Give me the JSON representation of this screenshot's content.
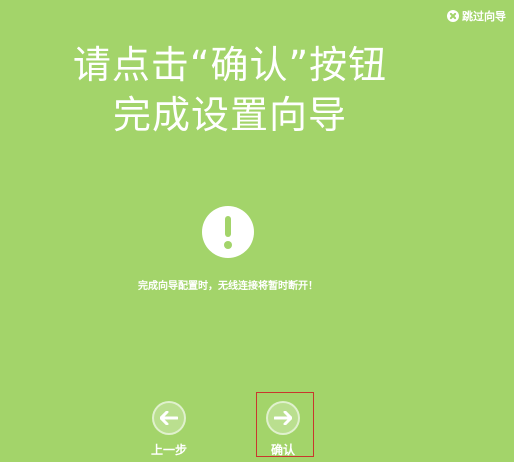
{
  "skip": {
    "label": "跳过向导"
  },
  "headline": {
    "line1": "请点击“确认”按钮",
    "line2": "完成设置向导"
  },
  "notice": {
    "text": "完成向导配置时，无线连接将暂时断开！"
  },
  "nav": {
    "back_label": "上一步",
    "confirm_label": "确认"
  },
  "colors": {
    "background": "#a3d46a",
    "highlight_border": "#c8372d"
  }
}
